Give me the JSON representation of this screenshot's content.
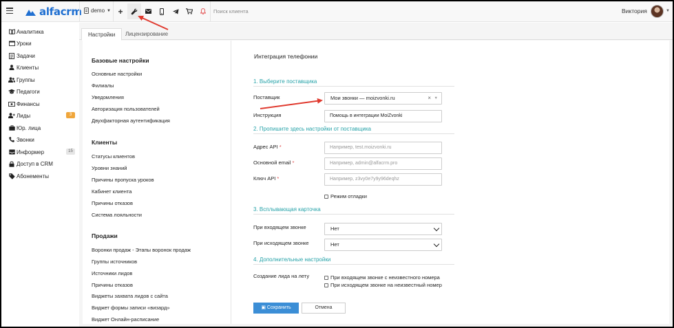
{
  "app": {
    "logo_text": "alfacrm",
    "brand_color": "#1f6fd1",
    "accent_color": "#26a2a8"
  },
  "topbar": {
    "branch": "demo",
    "icons": [
      "plus-icon",
      "wrench-icon",
      "mail-icon",
      "phone-icon",
      "telegram-icon",
      "cart-icon",
      "bell-icon"
    ],
    "search_placeholder": "Поиск клиента",
    "user_name": "Виктория"
  },
  "sidebar": {
    "items": [
      {
        "label": "Аналитика",
        "icon": "book-icon"
      },
      {
        "label": "Уроки",
        "icon": "calendar-icon"
      },
      {
        "label": "Задачи",
        "icon": "tasks-icon"
      },
      {
        "label": "Клиенты",
        "icon": "user-icon"
      },
      {
        "label": "Группы",
        "icon": "users-icon"
      },
      {
        "label": "Педагоги",
        "icon": "graduation-cap-icon"
      },
      {
        "label": "Финансы",
        "icon": "money-icon"
      },
      {
        "label": "Лиды",
        "icon": "user-plus-icon",
        "badge": "3"
      },
      {
        "label": "Юр. лица",
        "icon": "briefcase-icon"
      },
      {
        "label": "Звонки",
        "icon": "phone-icon"
      },
      {
        "label": "Информер",
        "icon": "inbox-icon",
        "badge": "15"
      },
      {
        "label": "Доступ в CRM",
        "icon": "lock-icon"
      },
      {
        "label": "Абонементы",
        "icon": "tag-icon"
      }
    ]
  },
  "tabs": {
    "settings": "Настройки",
    "licensing": "Лицензирование"
  },
  "settings_nav": {
    "base_heading": "Базовые настройки",
    "base_links": [
      "Основные настройки",
      "Филиалы",
      "Уведомления",
      "Авторизация пользователей",
      "Двухфакторная аутентификация"
    ],
    "clients_heading": "Клиенты",
    "clients_links": [
      "Статусы клиентов",
      "Уровни знаний",
      "Причины пропуска уроков",
      "Кабинет клиента",
      "Причины отказов",
      "Система лояльности"
    ],
    "sales_heading": "Продажи",
    "sales_links": [
      "Воронки продаж - Этапы воронок продаж",
      "Группы источников",
      "Источники лидов",
      "Причины отказов",
      "Виджеты захвата лидов с сайта",
      "Виджет формы записи «визард»",
      "Виджет Онлайн-расписание"
    ]
  },
  "form": {
    "title": "Интеграция телефонии",
    "section1": "1. Выберите поставщика",
    "provider_label": "Поставщик",
    "provider_value": "Мои звонки — moizvonki.ru",
    "instruction_label": "Инструкция",
    "instruction_value": "Помощь в интеграции MoiZvonki",
    "section2": "2. Пропишите здесь настройки от поставщика",
    "api_address_label": "Адрес API",
    "api_address_placeholder": "Например, test.moizvonki.ru",
    "email_label": "Основной email",
    "email_placeholder": "Например, admin@alfacrm.pro",
    "api_key_label": "Ключ API",
    "api_key_placeholder": "Например, z3vy0e7y9y96deqhz",
    "required_mark": "*",
    "debug_mode_label": "Режим отладки",
    "section3": "3. Всплывающая карточка",
    "incoming_label": "При входящем звонке",
    "incoming_value": "Нет",
    "outgoing_label": "При исходящем звонке",
    "outgoing_value": "Нет",
    "section4": "4. Дополнительные настройки",
    "create_lead_label": "Создание лида на лету",
    "incoming_unknown_label": "При входящем звонке с неизвестного номера",
    "outgoing_unknown_label": "При исходящем звонке на неизвестный номер",
    "save_label": "Сохранить",
    "cancel_label": "Отмена",
    "save_color": "#3b8ed6"
  },
  "annotations": {
    "arrow_color": "#e03a2f"
  }
}
